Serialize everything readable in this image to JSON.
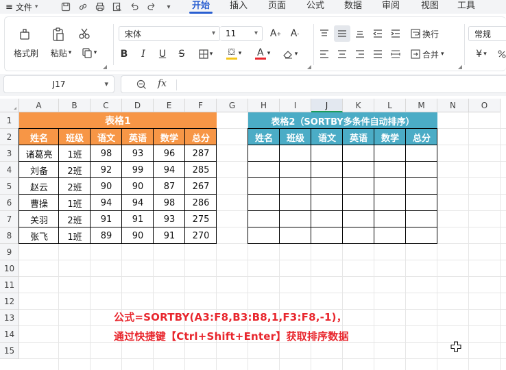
{
  "menu": {
    "file_label": "文件",
    "tabs": [
      {
        "label": "开始",
        "active": true
      },
      {
        "label": "插入",
        "active": false
      },
      {
        "label": "页面",
        "active": false
      },
      {
        "label": "公式",
        "active": false
      },
      {
        "label": "数据",
        "active": false
      },
      {
        "label": "审阅",
        "active": false
      },
      {
        "label": "视图",
        "active": false
      },
      {
        "label": "工具",
        "active": false
      }
    ],
    "quick_access_icons": [
      "save-icon",
      "link-icon",
      "print-icon",
      "print-preview-icon",
      "undo-icon",
      "redo-icon",
      "more-icon"
    ]
  },
  "ribbon": {
    "format_painter": "格式刷",
    "paste": "粘贴",
    "font_name": "宋体",
    "font_size": "11",
    "wrap_text": "换行",
    "merge": "合并",
    "number_format": "常规",
    "currency_symbol": "¥"
  },
  "formula_bar": {
    "name_box": "J17",
    "fx_label": "fx",
    "formula": ""
  },
  "grid": {
    "columns": [
      "A",
      "B",
      "C",
      "D",
      "E",
      "F",
      "G",
      "H",
      "I",
      "J",
      "K",
      "L",
      "M",
      "N",
      "O"
    ],
    "selected_column": "J",
    "rows": [
      "1",
      "2",
      "3",
      "4",
      "5",
      "6",
      "7",
      "8",
      "9",
      "10",
      "11",
      "12",
      "13",
      "14",
      "15"
    ]
  },
  "colors": {
    "accent": "#2a5fd1",
    "table1_header": "#f79646",
    "table2_header": "#4bacc6",
    "note": "#e8262d",
    "selected_col_border": "#1e9b5a"
  },
  "table1": {
    "title": "表格1",
    "headers": [
      "姓名",
      "班级",
      "语文",
      "英语",
      "数学",
      "总分"
    ],
    "rows": [
      [
        "诸葛亮",
        "1班",
        "98",
        "93",
        "96",
        "287"
      ],
      [
        "刘备",
        "2班",
        "92",
        "99",
        "94",
        "285"
      ],
      [
        "赵云",
        "2班",
        "90",
        "90",
        "87",
        "267"
      ],
      [
        "曹操",
        "1班",
        "94",
        "94",
        "98",
        "286"
      ],
      [
        "关羽",
        "2班",
        "91",
        "91",
        "93",
        "275"
      ],
      [
        "张飞",
        "1班",
        "89",
        "90",
        "91",
        "270"
      ]
    ]
  },
  "table2": {
    "title": "表格2（SORTBY多条件自动排序）",
    "headers": [
      "姓名",
      "班级",
      "语文",
      "英语",
      "数学",
      "总分"
    ],
    "empty_rows": 6
  },
  "annotation": {
    "line1": "公式=SORTBY(A3:F8,B3:B8,1,F3:F8,-1)，",
    "line2": "通过快捷键【Ctrl+Shift+Enter】获取排序数据"
  }
}
